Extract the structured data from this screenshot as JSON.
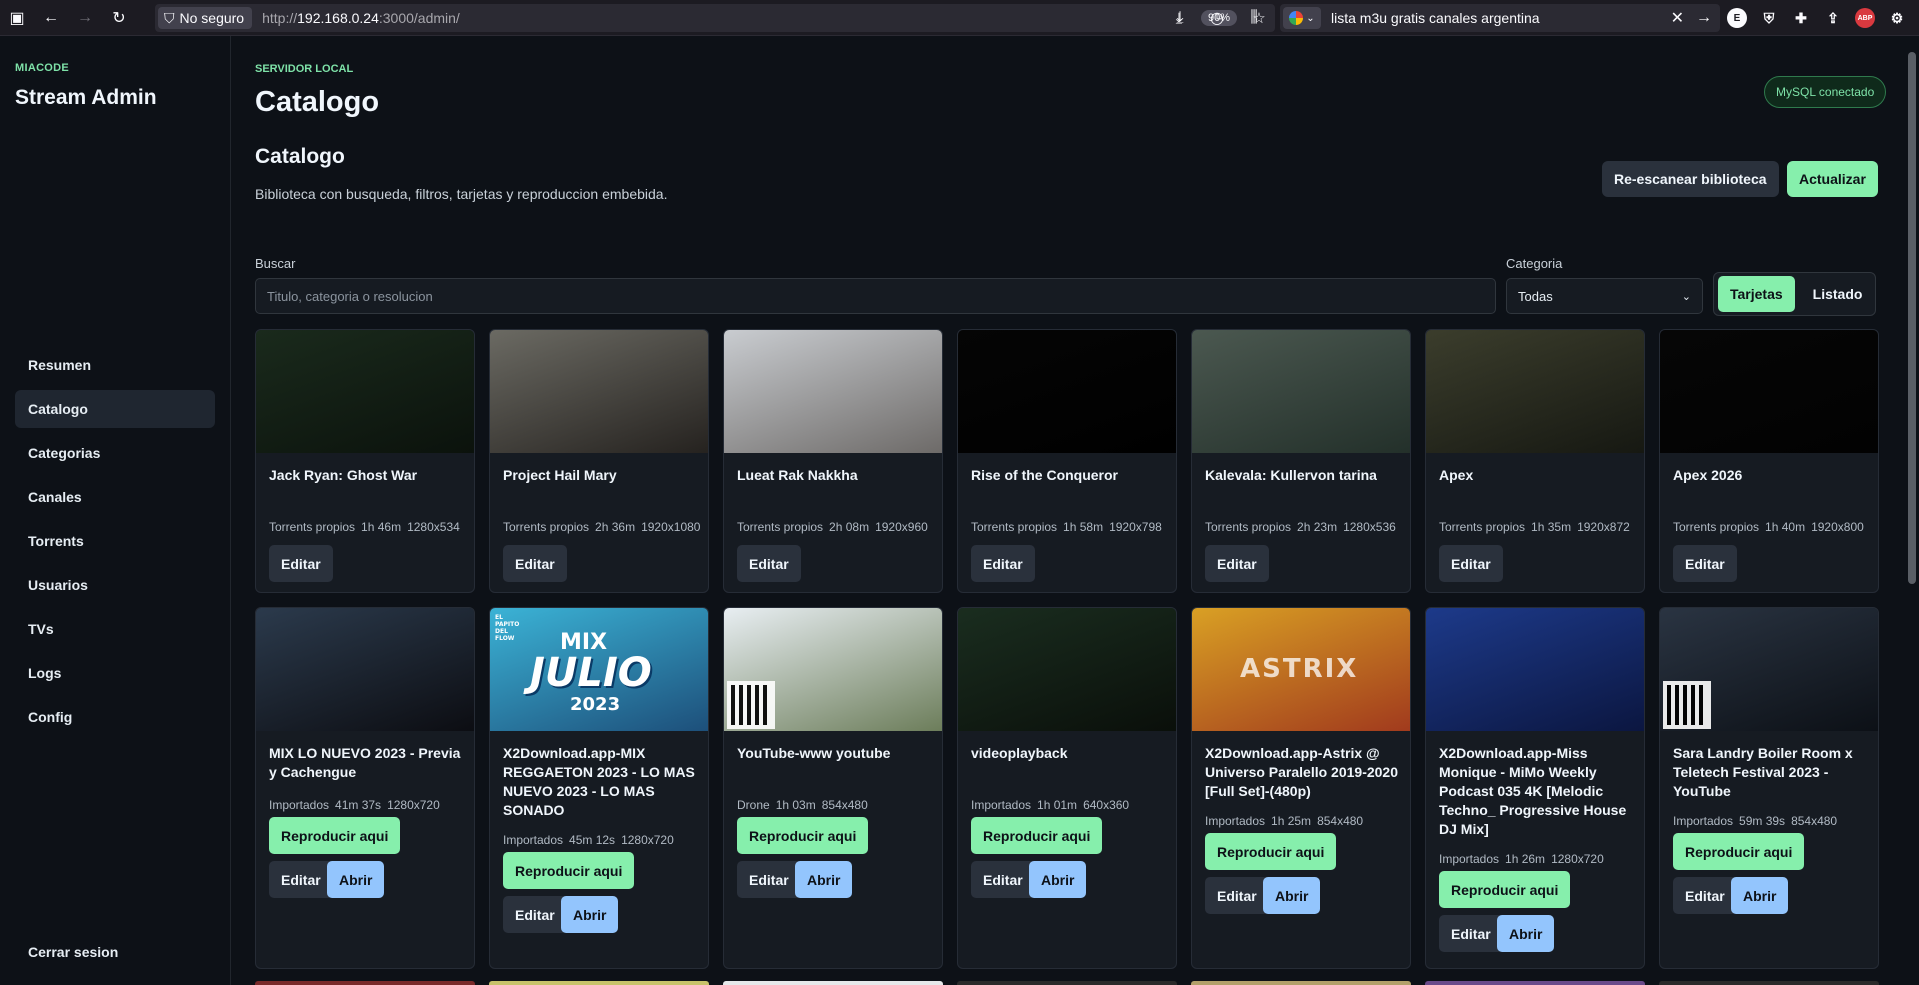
{
  "browser": {
    "security_label": "No seguro",
    "url_prefix": "http://",
    "url_host": "192.168.0.24",
    "url_rest": ":3000/admin/",
    "zoom": "90%",
    "search_query": "lista m3u gratis canales argentina"
  },
  "sidebar": {
    "kicker": "MIACODE",
    "title": "Stream Admin",
    "items": [
      {
        "label": "Resumen",
        "active": false
      },
      {
        "label": "Catalogo",
        "active": true
      },
      {
        "label": "Categorias",
        "active": false
      },
      {
        "label": "Canales",
        "active": false
      },
      {
        "label": "Torrents",
        "active": false
      },
      {
        "label": "Usuarios",
        "active": false
      },
      {
        "label": "TVs",
        "active": false
      },
      {
        "label": "Logs",
        "active": false
      },
      {
        "label": "Config",
        "active": false
      }
    ],
    "logout": "Cerrar sesion"
  },
  "header": {
    "kicker": "SERVIDOR LOCAL",
    "title": "Catalogo",
    "db_status": "MySQL conectado"
  },
  "section": {
    "title": "Catalogo",
    "description": "Biblioteca con busqueda, filtros, tarjetas y reproduccion embebida.",
    "rescan_label": "Re-escanear biblioteca",
    "refresh_label": "Actualizar"
  },
  "filters": {
    "search_label": "Buscar",
    "search_placeholder": "Titulo, categoria o resolucion",
    "category_label": "Categoria",
    "category_value": "Todas",
    "view_cards": "Tarjetas",
    "view_list": "Listado"
  },
  "buttons": {
    "edit": "Editar",
    "play": "Reproducir aqui",
    "open": "Abrir"
  },
  "cards": [
    {
      "title": "Jack Ryan: Ghost War",
      "source": "Torrents propios",
      "duration": "1h 46m",
      "resolution": "1280x534",
      "thumb": [
        "#1a2a1c",
        "#0b120c"
      ]
    },
    {
      "title": "Project Hail Mary",
      "source": "Torrents propios",
      "duration": "2h 36m",
      "resolution": "1920x1080",
      "thumb": [
        "#6b6a63",
        "#25221f"
      ]
    },
    {
      "title": "Lueat Rak Nakkha",
      "source": "Torrents propios",
      "duration": "2h 08m",
      "resolution": "1920x960",
      "thumb": [
        "#c9ccd0",
        "#6d6a68"
      ]
    },
    {
      "title": "Rise of the Conqueror",
      "source": "Torrents propios",
      "duration": "1h 58m",
      "resolution": "1920x798",
      "thumb": [
        "#050505",
        "#000000"
      ]
    },
    {
      "title": "Kalevala: Kullervon tarina",
      "source": "Torrents propios",
      "duration": "2h 23m",
      "resolution": "1280x536",
      "thumb": [
        "#4b5850",
        "#23302a"
      ]
    },
    {
      "title": "Apex",
      "source": "Torrents propios",
      "duration": "1h 35m",
      "resolution": "1920x872",
      "thumb": [
        "#3b3d2c",
        "#161812"
      ]
    },
    {
      "title": "Apex 2026",
      "source": "Torrents propios",
      "duration": "1h 40m",
      "resolution": "1920x800",
      "thumb": [
        "#060606",
        "#020202"
      ]
    },
    {
      "title": "MIX LO NUEVO 2023 - Previa y Cachengue",
      "source": "Importados",
      "duration": "41m 37s",
      "resolution": "1280x720",
      "thumb": [
        "#2b3a4c",
        "#0c0d12"
      ]
    },
    {
      "title": "X2Download.app-MIX REGGAETON 2023 - LO MAS NUEVO 2023 - LO MAS SONADO",
      "source": "Importados",
      "duration": "45m 12s",
      "resolution": "1280x720",
      "thumb": [
        "#3bb3d6",
        "#1d4f7a"
      ]
    },
    {
      "title": "YouTube-www youtube",
      "source": "Drone",
      "duration": "1h 03m",
      "resolution": "854x480",
      "thumb": [
        "#e8eef2",
        "#6c7d5a"
      ]
    },
    {
      "title": "videoplayback",
      "source": "Importados",
      "duration": "1h 01m",
      "resolution": "640x360",
      "thumb": [
        "#1a2d1f",
        "#0a0f0a"
      ]
    },
    {
      "title": "X2Download.app-Astrix @ Universo Paralello 2019-2020 [Full Set]-(480p)",
      "source": "Importados",
      "duration": "1h 25m",
      "resolution": "854x480",
      "thumb": [
        "#d9a024",
        "#a13a1d"
      ]
    },
    {
      "title": "X2Download.app-Miss Monique - MiMo Weekly Podcast 035 4K [Melodic Techno_ Progressive House DJ Mix]",
      "source": "Importados",
      "duration": "1h 26m",
      "resolution": "1280x720",
      "thumb": [
        "#1d3a8a",
        "#0b1640"
      ]
    },
    {
      "title": "Sara Landry Boiler Room x Teletech Festival 2023 - YouTube",
      "source": "Importados",
      "duration": "59m 39s",
      "resolution": "854x480",
      "thumb": [
        "#2a3442",
        "#0c1016"
      ]
    }
  ],
  "thumb_text": {
    "julio_mix": "MIX",
    "julio_word": "JULIO",
    "julio_year": "2023",
    "julio_corner": "EL PAPITO DEL FLOW",
    "astrix": "ASTRIX"
  }
}
